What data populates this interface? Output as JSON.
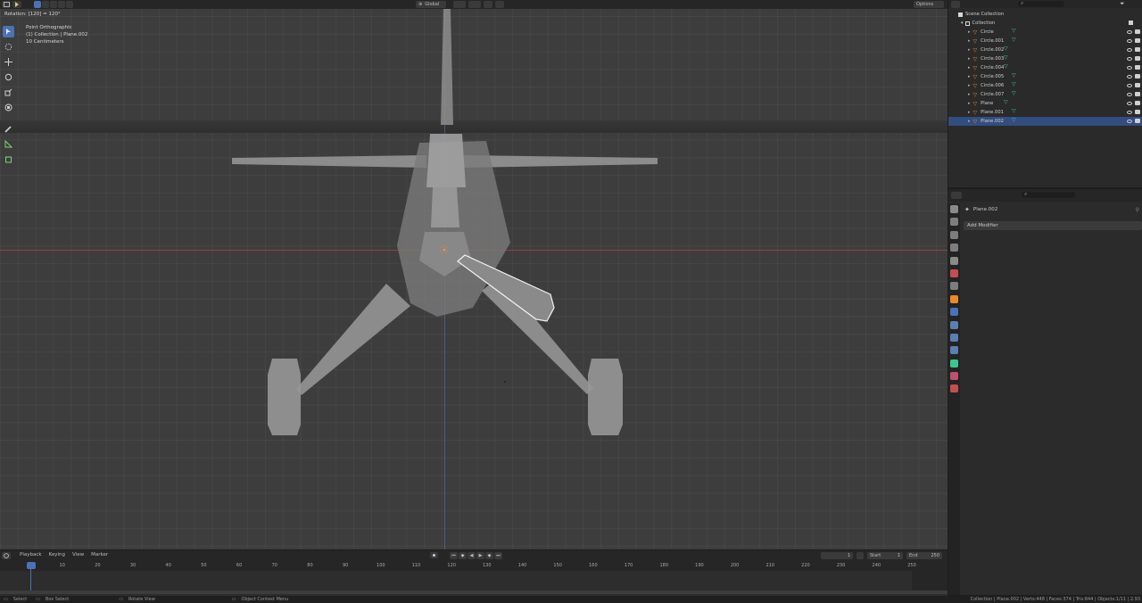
{
  "topbar": {
    "transform_orientation": "Global",
    "options_label": "Options"
  },
  "viewport": {
    "operator_hint": "Rotation: [120] = 120°",
    "view_name": "Point Orthographic",
    "collection_info": "(1) Collection | Plane.002",
    "grid_scale": "10 Centimeters"
  },
  "outliner": {
    "search_placeholder": "",
    "scene_collection": "Scene Collection",
    "collection": "Collection",
    "items": [
      {
        "label": "Circle",
        "selected": false
      },
      {
        "label": "Circle.001",
        "selected": false
      },
      {
        "label": "Circle.002",
        "selected": false
      },
      {
        "label": "Circle.003",
        "selected": false
      },
      {
        "label": "Circle.004",
        "selected": false
      },
      {
        "label": "Circle.005",
        "selected": false
      },
      {
        "label": "Circle.006",
        "selected": false
      },
      {
        "label": "Circle.007",
        "selected": false
      },
      {
        "label": "Plane",
        "selected": false
      },
      {
        "label": "Plane.001",
        "selected": false
      },
      {
        "label": "Plane.002",
        "selected": true
      }
    ]
  },
  "properties": {
    "search_placeholder": "",
    "object_name": "Plane.002",
    "add_modifier_label": "Add Modifier"
  },
  "timeline": {
    "menu": [
      "Playback",
      "Keying",
      "View",
      "Marker"
    ],
    "current_frame": "1",
    "start_label": "Start",
    "start_value": "1",
    "end_label": "End",
    "end_value": "250",
    "ruler_ticks": [
      "1",
      "10",
      "20",
      "30",
      "40",
      "50",
      "60",
      "70",
      "80",
      "90",
      "100",
      "110",
      "120",
      "130",
      "140",
      "150",
      "160",
      "170",
      "180",
      "190",
      "200",
      "210",
      "220",
      "230",
      "240",
      "250"
    ]
  },
  "statusbar": {
    "select": "Select",
    "box_select": "Box Select",
    "rotate_view": "Rotate View",
    "context_menu": "Object Context Menu",
    "stats": "Collection | Plane.002 | Verts:448 | Faces:374 | Tris:844 | Objects:1/11 | 2.93"
  },
  "colors": {
    "accent": "#4a72b5",
    "selection_row": "#334d80",
    "object_icon": "#e8892d",
    "mesh_icon": "#3ec48f",
    "x_axis": "#b84444",
    "y_axis": "#4f7fb8"
  }
}
